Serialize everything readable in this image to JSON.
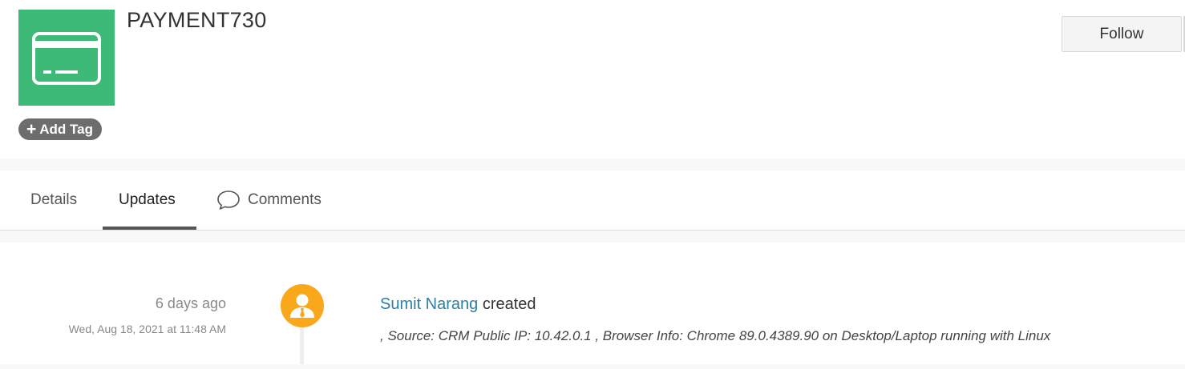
{
  "record": {
    "title": "PAYMENT730",
    "icon": "card-icon",
    "icon_color": "#3dba78"
  },
  "actions": {
    "follow_label": "Follow",
    "add_tag_label": "Add Tag"
  },
  "tabs": [
    {
      "label": "Details",
      "active": false
    },
    {
      "label": "Updates",
      "active": true
    },
    {
      "label": "Comments",
      "active": false,
      "icon": "comment-bubble-icon"
    }
  ],
  "feed": {
    "entries": [
      {
        "relative_time": "6 days ago",
        "absolute_time": "Wed, Aug 18, 2021 at 11:48 AM",
        "user": "Sumit Narang",
        "action": "created",
        "details": ", Source: CRM Public IP: 10.42.0.1 , Browser Info: Chrome 89.0.4389.90 on Desktop/Laptop running with Linux",
        "avatar_color": "#f9a81b"
      }
    ]
  },
  "colors": {
    "user_link": "#2c7fa5",
    "add_tag_bg": "#6d6d6d"
  }
}
